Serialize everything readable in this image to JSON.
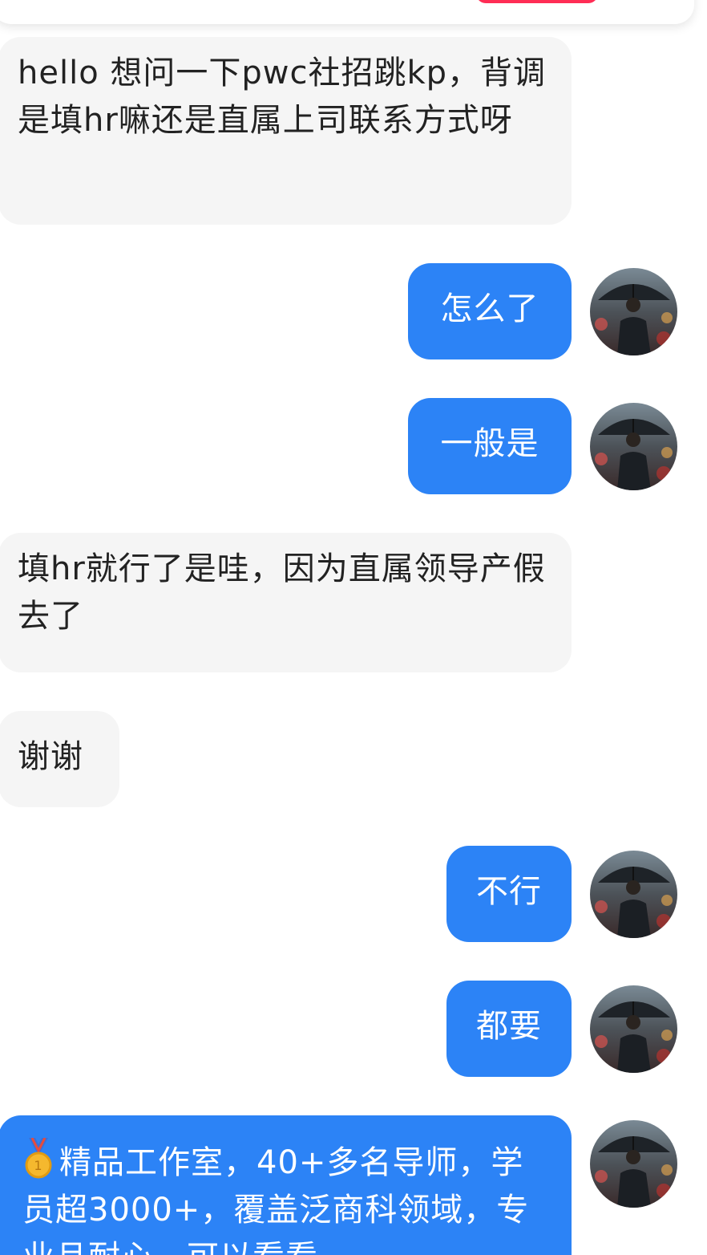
{
  "messages": [
    {
      "side": "in",
      "text": "hello 想问一下pwc社招跳kp，背调是填hr嘛还是直属上司联系方式呀"
    },
    {
      "side": "out",
      "text": "怎么了"
    },
    {
      "side": "out",
      "text": "一般是"
    },
    {
      "side": "in",
      "text": "填hr就行了是哇，因为直属领导产假去了"
    },
    {
      "side": "in",
      "text": "谢谢"
    },
    {
      "side": "out",
      "text": "不行"
    },
    {
      "side": "out",
      "text": "都要"
    },
    {
      "side": "out",
      "text": "精品工作室，40+多名导师，学员超3000+，覆盖泛商科领域，专业且耐心，可以看看"
    }
  ],
  "icons": {
    "medal": "gold-medal-icon",
    "avatar": "avatar-man-with-umbrella"
  },
  "colors": {
    "outgoing_bubble": "#2c83f6",
    "incoming_bubble": "#f5f5f5",
    "incoming_text": "#222222",
    "top_accent": "#ff2d55"
  }
}
